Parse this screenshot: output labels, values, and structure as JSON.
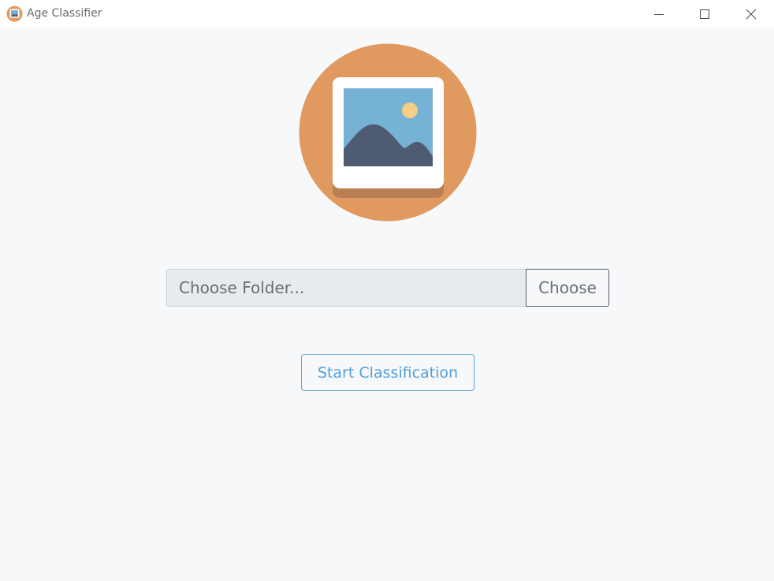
{
  "window": {
    "title": "Age Classifier",
    "controls": {
      "minimize_icon": "minimize-icon",
      "maximize_icon": "maximize-icon",
      "close_icon": "close-icon"
    }
  },
  "hero": {
    "icon": "image-icon",
    "colors": {
      "circle": "#e09a5f",
      "frame": "#ffffff",
      "frame_shadow": "#b97f52",
      "sky": "#76b1d6",
      "mountains": "#4f5b72",
      "sun": "#f4cd87"
    }
  },
  "folder_picker": {
    "placeholder": "Choose Folder...",
    "value": "",
    "button_label": "Choose"
  },
  "actions": {
    "start_label": "Start Classification",
    "accent_color": "#4f9fdc"
  }
}
